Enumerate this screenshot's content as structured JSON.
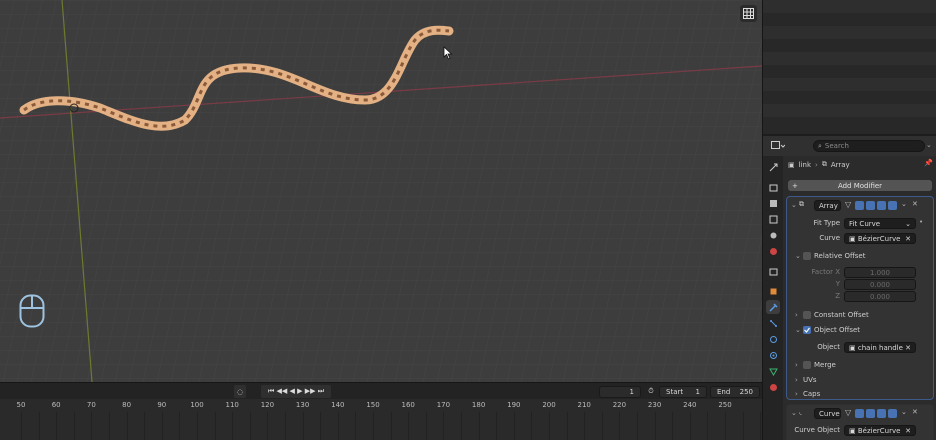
{
  "viewport": {
    "cursor_icon": "mouse-pointer-icon",
    "gizmo_icon": "grid-view-icon",
    "mouse_hint_icon": "mouse-icon"
  },
  "timeline": {
    "current_frame": "1",
    "start_label": "Start",
    "start_value": "1",
    "end_label": "End",
    "end_value": "250",
    "ruler": [
      "50",
      "60",
      "70",
      "80",
      "90",
      "100",
      "110",
      "120",
      "130",
      "140",
      "150",
      "160",
      "170",
      "180",
      "190",
      "200",
      "210",
      "220",
      "230",
      "240",
      "250"
    ]
  },
  "outliner": {
    "search_placeholder": "Search"
  },
  "properties": {
    "breadcrumb_object": "link",
    "breadcrumb_modifier": "Array",
    "add_modifier_label": "Add Modifier",
    "array": {
      "name": "Array",
      "fit_type_label": "Fit Type",
      "fit_type_value": "Fit Curve",
      "curve_label": "Curve",
      "curve_value": "BézierCurve",
      "relative_offset_label": "Relative Offset",
      "factor_x_label": "Factor X",
      "factor_x_value": "1.000",
      "y_label": "Y",
      "y_value": "0.000",
      "z_label": "Z",
      "z_value": "0.000",
      "constant_offset_label": "Constant Offset",
      "object_offset_label": "Object Offset",
      "object_label": "Object",
      "object_value": "chain handle",
      "merge_label": "Merge",
      "uvs_label": "UVs",
      "caps_label": "Caps"
    },
    "curve_mod": {
      "name": "Curve",
      "curve_object_label": "Curve Object",
      "curve_object_value": "BézierCurve"
    }
  }
}
